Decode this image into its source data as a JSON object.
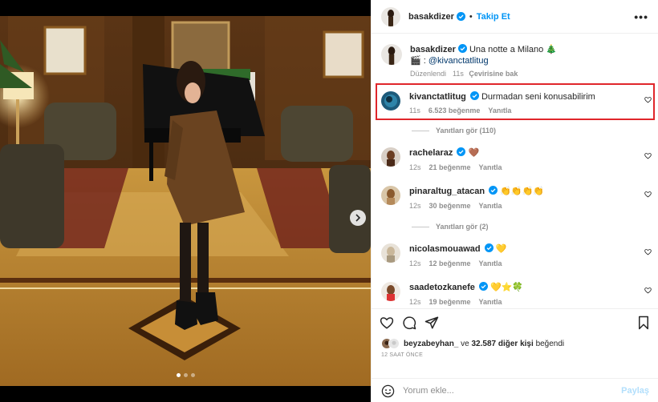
{
  "header": {
    "username": "basakdizer",
    "separator": "•",
    "follow_label": "Takip Et",
    "more_label": "•••"
  },
  "caption": {
    "username": "basakdizer",
    "text": "Una notte a Milano 🎄",
    "credit_prefix": "🎬 :",
    "credit_mention": "@kivanctatlitug",
    "edited_label": "Düzenlendi",
    "time": "11s",
    "translate_label": "Çevirisine bak"
  },
  "comments": [
    {
      "username": "kivanctatlitug",
      "text": "Durmadan seni konusabilirim",
      "time": "11s",
      "likes": "6.523 beğenme",
      "reply_label": "Yanıtla"
    },
    {
      "username": "rachelaraz",
      "text": "🤎",
      "time": "12s",
      "likes": "21 beğenme",
      "reply_label": "Yanıtla"
    },
    {
      "username": "pinaraltug_atacan",
      "text": "👏👏👏👏",
      "time": "12s",
      "likes": "30 beğenme",
      "reply_label": "Yanıtla"
    },
    {
      "username": "nicolasmouawad",
      "text": "💛",
      "time": "12s",
      "likes": "12 beğenme",
      "reply_label": "Yanıtla"
    },
    {
      "username": "saadetozkanefe",
      "text": "💛⭐🍀",
      "time": "12s",
      "likes": "19 beğenme",
      "reply_label": "Yanıtla"
    }
  ],
  "replies": [
    {
      "label": "Yanıtları gör (110)"
    },
    {
      "label": "Yanıtları gör (2)"
    }
  ],
  "likes": {
    "liker": "beyzabeyhan_",
    "connector": "ve",
    "others": "32.587 diğer kişi",
    "suffix": "beğendi"
  },
  "post_time": "12 SAAT ÖNCE",
  "comment_box": {
    "placeholder": "Yorum ekle...",
    "post_label": "Paylaş"
  },
  "carousel": {
    "slide_count": 3,
    "active_index": 0
  },
  "colors": {
    "accent": "#0095f6",
    "highlight": "#e0262b",
    "verified": "#0095f6"
  },
  "icons": [
    "heart-icon",
    "comment-icon",
    "share-icon",
    "bookmark-icon",
    "emoji-icon",
    "verified-icon",
    "chevron-right-icon"
  ]
}
